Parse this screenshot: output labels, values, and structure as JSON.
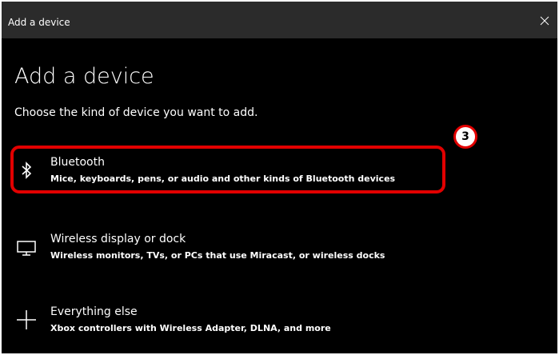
{
  "window": {
    "title": "Add a device",
    "close_icon": "close-icon"
  },
  "page": {
    "heading": "Add a device",
    "subtitle": "Choose the kind of device you want to add."
  },
  "options": [
    {
      "title": "Bluetooth",
      "description": "Mice, keyboards, pens, or audio and other kinds of Bluetooth devices",
      "icon": "bluetooth-icon"
    },
    {
      "title": "Wireless display or dock",
      "description": "Wireless monitors, TVs, or PCs that use Miracast, or wireless docks",
      "icon": "monitor-icon"
    },
    {
      "title": "Everything else",
      "description": "Xbox controllers with Wireless Adapter, DLNA, and more",
      "icon": "plus-icon"
    }
  ],
  "annotation": {
    "step_number": "3",
    "highlight_color": "#e20000"
  },
  "colors": {
    "background": "#000000",
    "titlebar": "#2b2b2b",
    "text": "#ffffff"
  }
}
